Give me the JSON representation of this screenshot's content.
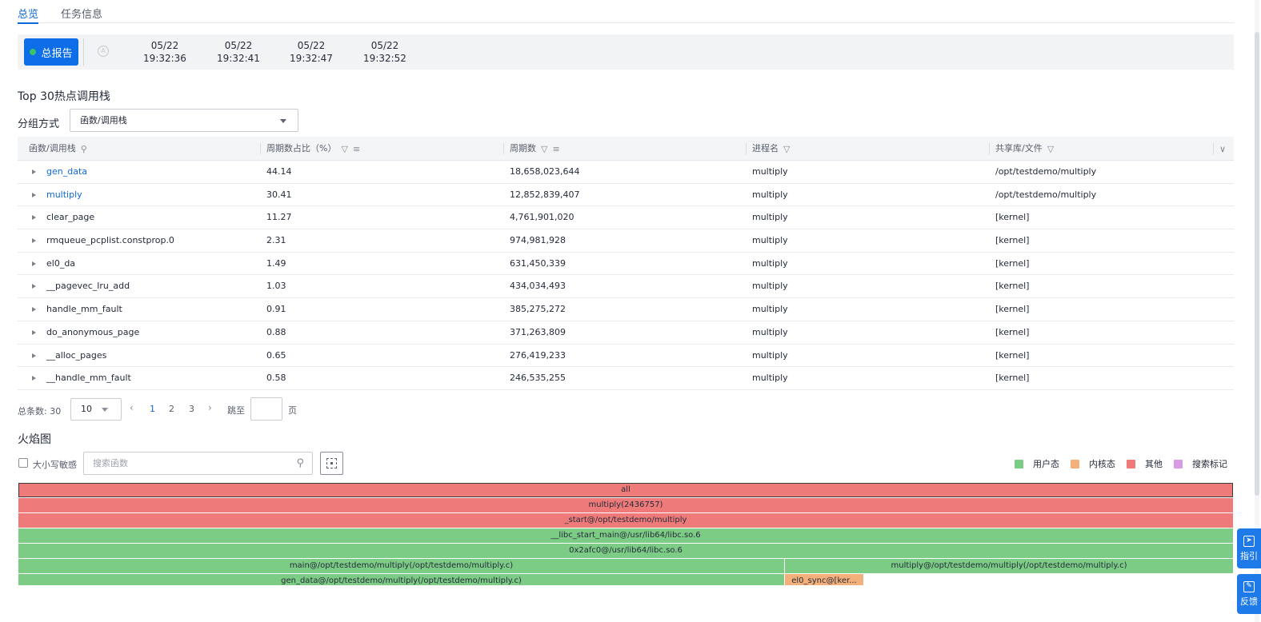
{
  "tabs": [
    {
      "label": "总览",
      "active": true
    },
    {
      "label": "任务信息",
      "active": false
    }
  ],
  "timeline": {
    "report_button": "总报告",
    "auto_icon_text": "A",
    "items": [
      {
        "date": "05/22",
        "time": "19:32:36"
      },
      {
        "date": "05/22",
        "time": "19:32:41"
      },
      {
        "date": "05/22",
        "time": "19:32:47"
      },
      {
        "date": "05/22",
        "time": "19:32:52"
      }
    ]
  },
  "hot_stack": {
    "title": "Top 30热点调用栈",
    "group_label": "分组方式",
    "group_value": "函数/调用栈",
    "columns": [
      "函数/调用栈",
      "周期数占比（%）",
      "周期数",
      "进程名",
      "共享库/文件"
    ],
    "rows": [
      {
        "func": "gen_data",
        "pct": "44.14",
        "cycles": "18,658,023,644",
        "proc": "multiply",
        "lib": "/opt/testdemo/multiply",
        "link": true
      },
      {
        "func": "multiply",
        "pct": "30.41",
        "cycles": "12,852,839,407",
        "proc": "multiply",
        "lib": "/opt/testdemo/multiply",
        "link": true
      },
      {
        "func": "clear_page",
        "pct": "11.27",
        "cycles": "4,761,901,020",
        "proc": "multiply",
        "lib": "[kernel]",
        "link": false
      },
      {
        "func": "rmqueue_pcplist.constprop.0",
        "pct": "2.31",
        "cycles": "974,981,928",
        "proc": "multiply",
        "lib": "[kernel]",
        "link": false
      },
      {
        "func": "el0_da",
        "pct": "1.49",
        "cycles": "631,450,339",
        "proc": "multiply",
        "lib": "[kernel]",
        "link": false
      },
      {
        "func": "__pagevec_lru_add",
        "pct": "1.03",
        "cycles": "434,034,493",
        "proc": "multiply",
        "lib": "[kernel]",
        "link": false
      },
      {
        "func": "handle_mm_fault",
        "pct": "0.91",
        "cycles": "385,275,272",
        "proc": "multiply",
        "lib": "[kernel]",
        "link": false
      },
      {
        "func": "do_anonymous_page",
        "pct": "0.88",
        "cycles": "371,263,809",
        "proc": "multiply",
        "lib": "[kernel]",
        "link": false
      },
      {
        "func": "__alloc_pages",
        "pct": "0.65",
        "cycles": "276,419,233",
        "proc": "multiply",
        "lib": "[kernel]",
        "link": false
      },
      {
        "func": "__handle_mm_fault",
        "pct": "0.58",
        "cycles": "246,535,255",
        "proc": "multiply",
        "lib": "[kernel]",
        "link": false
      }
    ]
  },
  "pagination": {
    "total_label": "总条数: 30",
    "page_size": "10",
    "pages": [
      "1",
      "2",
      "3"
    ],
    "current_page": "1",
    "jump_label": "跳至",
    "page_label": "页"
  },
  "flame": {
    "title": "火焰图",
    "case_label": "大小写敏感",
    "search_placeholder": "搜索函数",
    "legend": [
      {
        "label": "用户态",
        "color": "#7dcc85"
      },
      {
        "label": "内核态",
        "color": "#f4b07a"
      },
      {
        "label": "其他",
        "color": "#ee7b79"
      },
      {
        "label": "搜索标记",
        "color": "#d99ae6"
      }
    ],
    "frames": [
      {
        "label": "all",
        "level": 0,
        "start": 0,
        "width": 1,
        "kind": "other",
        "outlined": true
      },
      {
        "label": "multiply(2436757)",
        "level": 1,
        "start": 0,
        "width": 1,
        "kind": "other"
      },
      {
        "label": "_start@/opt/testdemo/multiply",
        "level": 2,
        "start": 0,
        "width": 1,
        "kind": "other"
      },
      {
        "label": "__libc_start_main@/usr/lib64/libc.so.6",
        "level": 3,
        "start": 0,
        "width": 1,
        "kind": "user"
      },
      {
        "label": "0x2afc0@/usr/lib64/libc.so.6",
        "level": 4,
        "start": 0,
        "width": 1,
        "kind": "user"
      },
      {
        "label": "main@/opt/testdemo/multiply(/opt/testdemo/multiply.c)",
        "level": 5,
        "start": 0,
        "width": 0.631,
        "kind": "user"
      },
      {
        "label": "multiply@/opt/testdemo/multiply(/opt/testdemo/multiply.c)",
        "level": 5,
        "start": 0.631,
        "width": 0.369,
        "kind": "user"
      },
      {
        "label": "gen_data@/opt/testdemo/multiply(/opt/testdemo/multiply.c)",
        "level": 6,
        "start": 0,
        "width": 0.631,
        "kind": "user"
      },
      {
        "label": "el0_sync@[ker...",
        "level": 6,
        "start": 0.631,
        "width": 0.065,
        "kind": "kernel"
      }
    ]
  },
  "floating": {
    "guide_label": "指引",
    "feedback_label": "反馈"
  }
}
